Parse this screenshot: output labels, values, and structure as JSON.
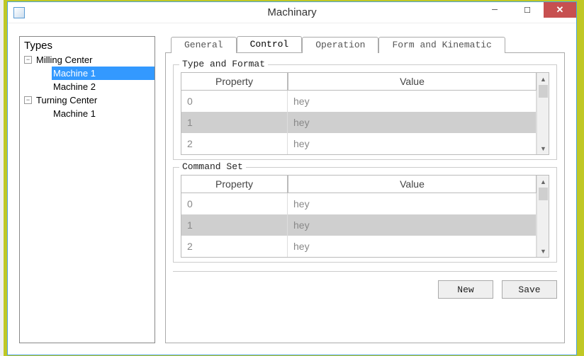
{
  "window": {
    "title": "Machinary"
  },
  "tree": {
    "title": "Types",
    "nodes": [
      {
        "label": "Milling Center",
        "expanded": true,
        "children": [
          {
            "label": "Machine 1",
            "selected": true
          },
          {
            "label": "Machine 2"
          }
        ]
      },
      {
        "label": "Turning Center",
        "expanded": true,
        "children": [
          {
            "label": "Machine 1"
          }
        ]
      }
    ]
  },
  "tabs": [
    {
      "label": "General",
      "active": false
    },
    {
      "label": "Control",
      "active": true
    },
    {
      "label": "Operation",
      "active": false
    },
    {
      "label": "Form and Kinematic",
      "active": false
    }
  ],
  "group1": {
    "title": "Type and Format",
    "col_prop": "Property",
    "col_val": "Value",
    "rows": [
      {
        "prop": "0",
        "val": "hey"
      },
      {
        "prop": "1",
        "val": "hey"
      },
      {
        "prop": "2",
        "val": "hey"
      }
    ]
  },
  "group2": {
    "title": "Command Set",
    "col_prop": "Property",
    "col_val": "Value",
    "rows": [
      {
        "prop": "0",
        "val": "hey"
      },
      {
        "prop": "1",
        "val": "hey"
      },
      {
        "prop": "2",
        "val": "hey"
      }
    ]
  },
  "buttons": {
    "new": "New",
    "save": "Save"
  }
}
